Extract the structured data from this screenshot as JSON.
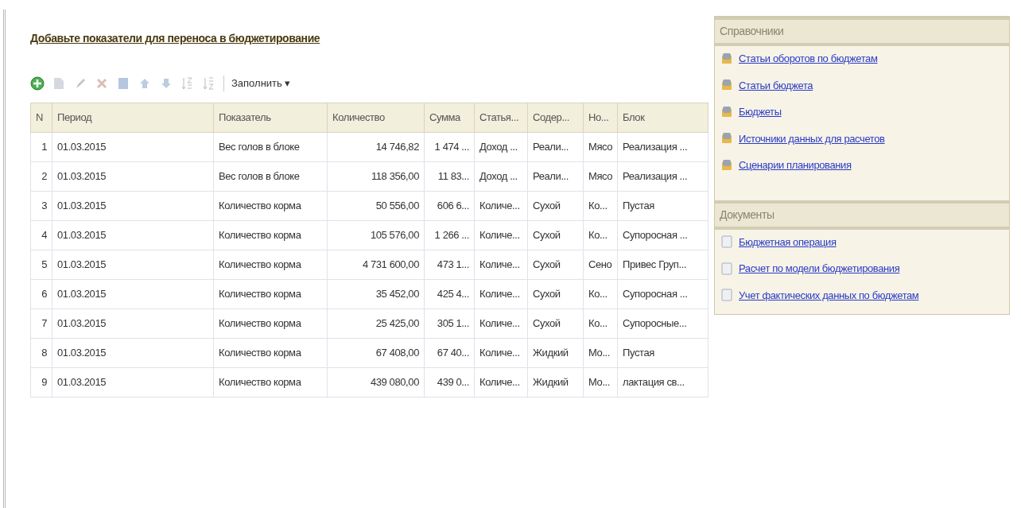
{
  "form": {
    "title": "Добавьте показатели для переноса в бюджетирование"
  },
  "toolbar": {
    "buttons": [
      {
        "kind": "add",
        "disabled": false
      },
      {
        "kind": "copy",
        "disabled": true
      },
      {
        "kind": "edit",
        "disabled": true
      },
      {
        "kind": "delete",
        "disabled": true
      },
      {
        "kind": "square",
        "disabled": true
      },
      {
        "kind": "up",
        "disabled": true
      },
      {
        "kind": "down",
        "disabled": true
      },
      {
        "kind": "sort-asc",
        "disabled": true
      },
      {
        "kind": "sort-desc",
        "disabled": true
      }
    ],
    "fill_menu": {
      "label": "Заполнить",
      "caret": "▾"
    }
  },
  "table": {
    "columns": [
      "N",
      "Период",
      "Показатель",
      "Количество",
      "Сумма",
      "Статья...",
      "Содер...",
      "Но...",
      "Блок"
    ],
    "rows": [
      [
        "1",
        "01.03.2015",
        "Вес голов в блоке",
        "14 746,82",
        "1 474 ...",
        "Доход ...",
        "Реали...",
        "Мясо",
        "Реализация ..."
      ],
      [
        "2",
        "01.03.2015",
        "Вес голов в блоке",
        "118 356,00",
        "11 83...",
        "Доход ...",
        "Реали...",
        "Мясо",
        "Реализация ..."
      ],
      [
        "3",
        "01.03.2015",
        "Количество корма",
        "50 556,00",
        "606 6...",
        "Количе...",
        "Сухой",
        "Ко...",
        "Пустая"
      ],
      [
        "4",
        "01.03.2015",
        "Количество корма",
        "105 576,00",
        "1 266 ...",
        "Количе...",
        "Сухой",
        "Ко...",
        "Супоросная ..."
      ],
      [
        "5",
        "01.03.2015",
        "Количество корма",
        "4 731 600,00",
        "473 1...",
        "Количе...",
        "Сухой",
        "Сено",
        "Привес Груп..."
      ],
      [
        "6",
        "01.03.2015",
        "Количество корма",
        "35 452,00",
        "425 4...",
        "Количе...",
        "Сухой",
        "Ко...",
        "Супоросная ..."
      ],
      [
        "7",
        "01.03.2015",
        "Количество корма",
        "25 425,00",
        "305 1...",
        "Количе...",
        "Сухой",
        "Ко...",
        "Супоросные..."
      ],
      [
        "8",
        "01.03.2015",
        "Количество корма",
        "67 408,00",
        "67 40...",
        "Количе...",
        "Жидкий",
        "Мо...",
        "Пустая"
      ],
      [
        "9",
        "01.03.2015",
        "Количество корма",
        "439 080,00",
        "439 0...",
        "Количе...",
        "Жидкий",
        "Мо...",
        "лактация св..."
      ]
    ]
  },
  "side_panels": [
    {
      "title": "Справочники",
      "items": [
        {
          "label": "Статьи оборотов по бюджетам",
          "kind": "catalog"
        },
        {
          "label": "Статьи бюджета",
          "kind": "catalog"
        },
        {
          "label": "Бюджеты",
          "kind": "catalog"
        },
        {
          "label": "Источники данных для расчетов",
          "kind": "catalog"
        },
        {
          "label": "Сценарии планирования",
          "kind": "catalog"
        }
      ]
    },
    {
      "title": "Документы",
      "items": [
        {
          "label": "Бюджетная операция",
          "kind": "document"
        },
        {
          "label": "Расчет по модели бюджетирования",
          "kind": "document"
        },
        {
          "label": "Учет фактических данных по бюджетам",
          "kind": "document"
        }
      ]
    }
  ]
}
